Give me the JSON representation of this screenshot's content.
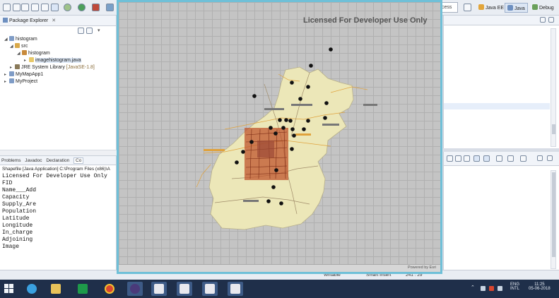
{
  "toolbar": {
    "quick_access": "cess",
    "perspectives": [
      {
        "label": "Java EE",
        "active": false
      },
      {
        "label": "Java",
        "active": true
      },
      {
        "label": "Debug",
        "active": false
      }
    ]
  },
  "package_explorer": {
    "tab_label": "Package Explorer",
    "tab_close": "✕",
    "tree": [
      {
        "label": "histogram",
        "suffix": ""
      },
      {
        "label": "src",
        "suffix": ""
      },
      {
        "label": "histogram",
        "suffix": ""
      },
      {
        "label": "imagehistogram.java",
        "suffix": ""
      },
      {
        "label": "JRE System Library",
        "suffix": " [JavaSE-1.8]"
      },
      {
        "label": "MyMapApp1",
        "suffix": ""
      },
      {
        "label": "MyProject",
        "suffix": ""
      }
    ]
  },
  "console": {
    "tabs": [
      "Problems",
      "Javadoc",
      "Declaration",
      "Co"
    ],
    "description": "Shapefile [Java Application] C:\\Program Files (x86)\\A",
    "lines": [
      "Licensed For Developer Use Only",
      "FID",
      "Name___Add",
      "Capacity",
      "Supply_Are",
      "Population",
      "Latitude",
      "Longitude",
      "In_charge",
      "Adjoining",
      "Image"
    ]
  },
  "map": {
    "license_text": "Licensed For Developer Use Only",
    "powered_by": "Powered by Esri",
    "colors": {
      "frame": "#6fc0d8",
      "region": "#ece7b8",
      "dense": "#c0562e",
      "point": "#111111"
    }
  },
  "statusbar": {
    "writable": "Writable",
    "insert_mode": "Smart Insert",
    "position": "241 : 29"
  },
  "taskbar": {
    "apps": [
      "file-explorer-icon",
      "internet-explorer-icon",
      "folder-icon",
      "store-icon",
      "chrome-icon",
      "eclipse-icon",
      "java-app-icon",
      "java-app-icon",
      "java-app-icon",
      "java-app-icon"
    ],
    "tray": {
      "lang_top": "ENG",
      "lang_bottom": "INTL",
      "time": "11:25",
      "date": "05-06-2018"
    }
  }
}
